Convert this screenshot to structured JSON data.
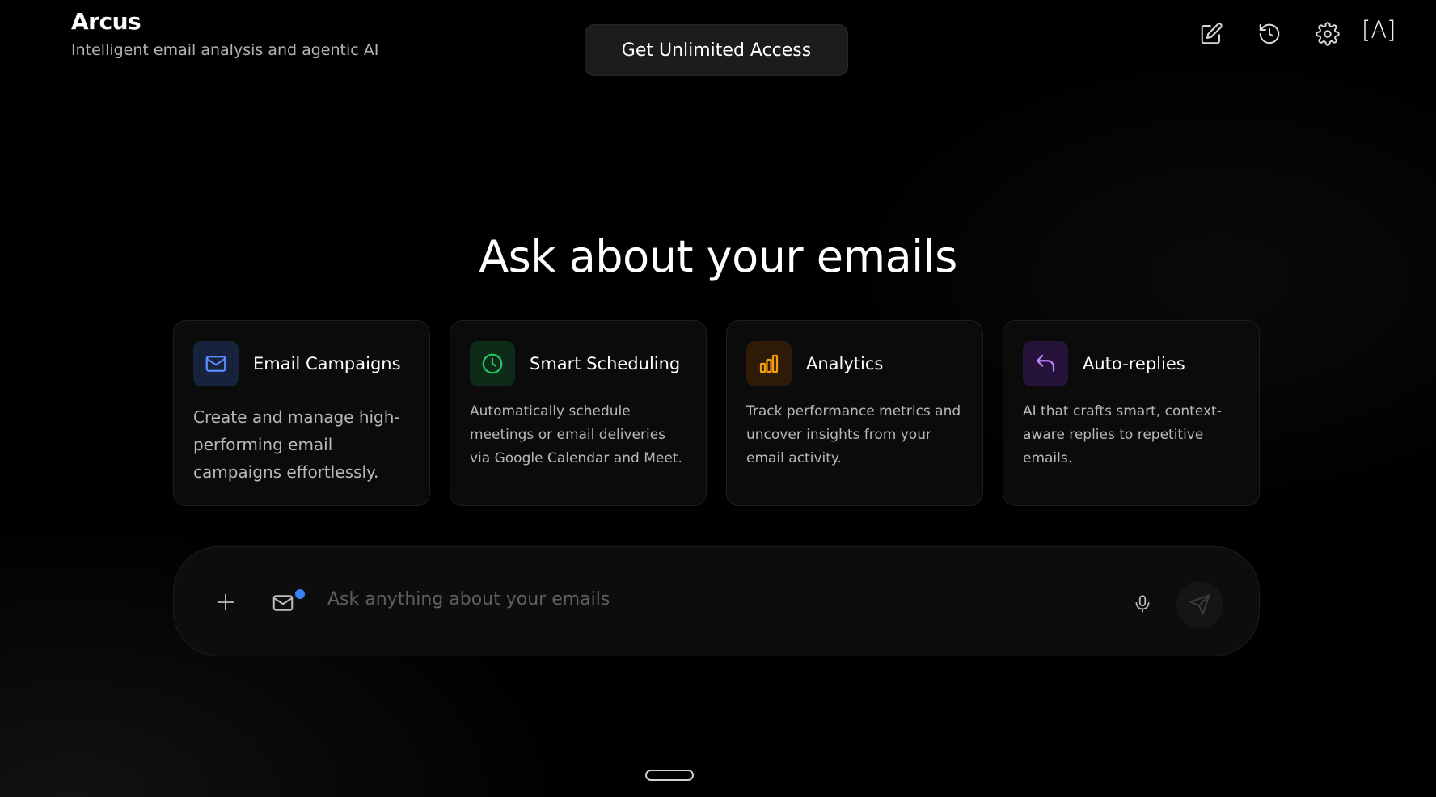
{
  "header": {
    "app_title": "Arcus",
    "app_subtitle": "Intelligent email analysis and agentic AI",
    "cta_label": "Get Unlimited Access",
    "toolbar": {
      "icons": [
        "edit-icon",
        "history-icon",
        "settings-icon"
      ],
      "account_badge": "[A]"
    }
  },
  "main": {
    "heading": "Ask about your emails",
    "cards": [
      {
        "title": "Email Campaigns",
        "description": "Create and manage high-performing email campaigns effortlessly.",
        "icon": "mail-icon",
        "accent": "#5b8cff",
        "icon_bg": "#17233d"
      },
      {
        "title": "Smart Scheduling",
        "description": "Automatically schedule meetings or email deliveries via Google Calendar and Meet.",
        "icon": "clock-icon",
        "accent": "#22c55e",
        "icon_bg": "#0f2a18"
      },
      {
        "title": "Analytics",
        "description": "Track performance metrics and uncover insights from your email activity.",
        "icon": "bar-chart-icon",
        "accent": "#f59e0b",
        "icon_bg": "#2e1a08"
      },
      {
        "title": "Auto-replies",
        "description": "AI that crafts smart, context-aware replies to repetitive emails.",
        "icon": "reply-icon",
        "accent": "#c084fc",
        "icon_bg": "#26133a"
      }
    ]
  },
  "composer": {
    "placeholder": "Ask anything about your emails",
    "value": "",
    "icons": [
      "plus-icon",
      "mail-icon",
      "microphone-icon",
      "send-icon"
    ],
    "notification_color": "#3b82f6"
  }
}
